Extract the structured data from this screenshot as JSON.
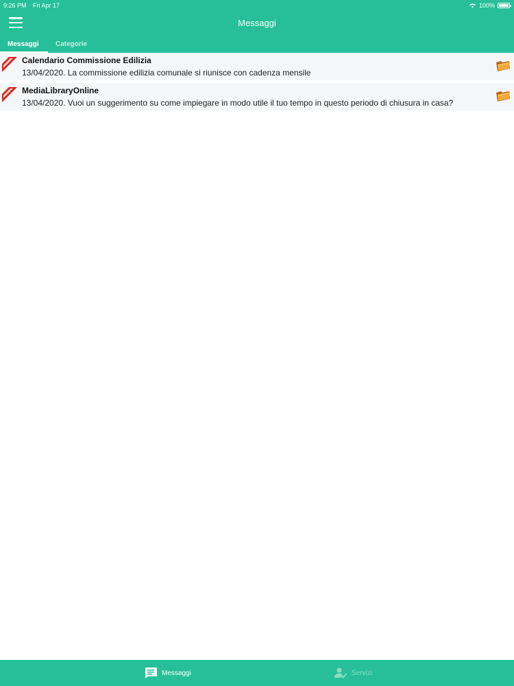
{
  "status_bar": {
    "time": "9:26 PM",
    "date": "Fri Apr 17",
    "battery": "100%"
  },
  "header": {
    "title": "Messaggi",
    "menu_icon": "hamburger-menu-icon"
  },
  "tabs": {
    "active": "Messaggi",
    "inactive": "Categorie"
  },
  "messages": [
    {
      "title": "Calendario Commissione Edilizia",
      "text": "13/04/2020. La commissione edilizia comunale si riunisce con cadenza mensile",
      "badge_icon": "new-ribbon-icon",
      "action_icon": "folder-icon"
    },
    {
      "title": "MediaLibraryOnline",
      "text": "13/04/2020. Vuoi un suggerimento su come impiegare in modo utile il tuo tempo in questo periodo di chiusura in casa?",
      "badge_icon": "new-ribbon-icon",
      "action_icon": "folder-icon"
    }
  ],
  "bottom_nav": {
    "messages_label": "Messaggi",
    "services_label": "Servizi"
  },
  "colors": {
    "accent": "#26bf99",
    "row_background": "#f5f6f8"
  }
}
